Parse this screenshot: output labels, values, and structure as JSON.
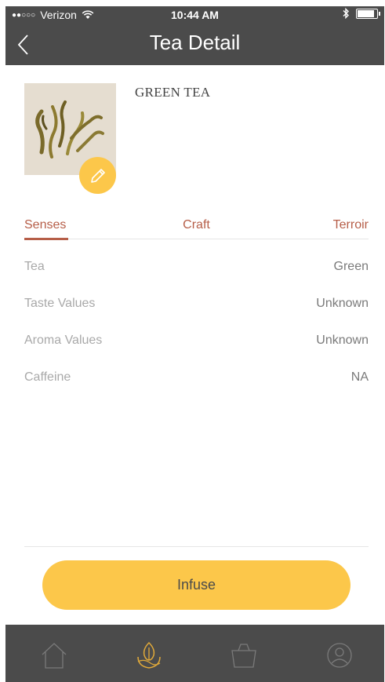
{
  "status_bar": {
    "signal": "●●○○○",
    "carrier": "Verizon",
    "time": "10:44 AM"
  },
  "nav": {
    "title": "Tea Detail"
  },
  "product": {
    "name": "GREEN TEA"
  },
  "tabs": [
    {
      "label": "Senses",
      "active": true
    },
    {
      "label": "Craft",
      "active": false
    },
    {
      "label": "Terroir",
      "active": false
    }
  ],
  "details": [
    {
      "label": "Tea",
      "value": "Green"
    },
    {
      "label": "Taste Values",
      "value": "Unknown"
    },
    {
      "label": "Aroma Values",
      "value": "Unknown"
    },
    {
      "label": "Caffeine",
      "value": "NA"
    }
  ],
  "actions": {
    "infuse_label": "Infuse"
  },
  "tabbar": {
    "items": [
      "home-icon",
      "tea-leaf-icon",
      "basket-icon",
      "profile-icon"
    ],
    "active_index": 1
  },
  "colors": {
    "header_bg": "#4b4b4b",
    "accent": "#b65e48",
    "button": "#fcc74a"
  }
}
